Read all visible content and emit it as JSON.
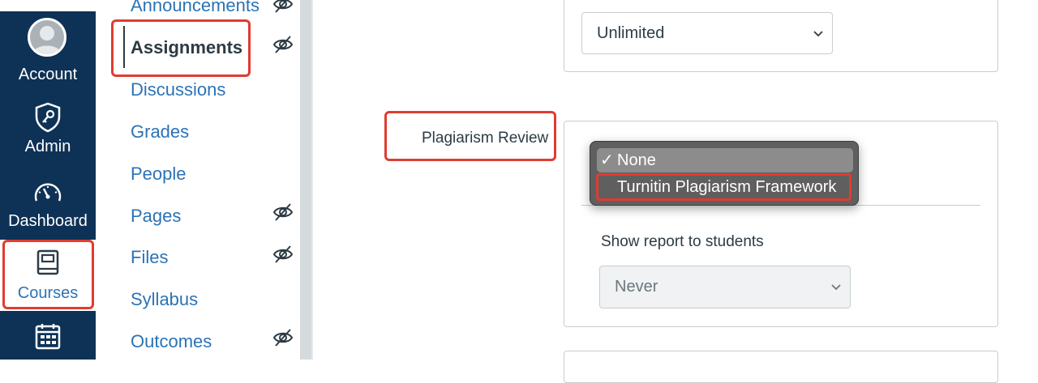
{
  "global_nav": {
    "account": "Account",
    "admin": "Admin",
    "dashboard": "Dashboard",
    "courses": "Courses"
  },
  "course_nav": {
    "items": [
      {
        "label": "Announcements"
      },
      {
        "label": "Assignments"
      },
      {
        "label": "Discussions"
      },
      {
        "label": "Grades"
      },
      {
        "label": "People"
      },
      {
        "label": "Pages"
      },
      {
        "label": "Files"
      },
      {
        "label": "Syllabus"
      },
      {
        "label": "Outcomes"
      }
    ]
  },
  "main": {
    "attempts_select_value": "Unlimited",
    "plagiarism_label": "Plagiarism Review",
    "plagiarism_options": [
      "None",
      "Turnitin Plagiarism Framework"
    ],
    "plagiarism_checkmark": "✓",
    "show_report_label": "Show report to students",
    "show_report_value": "Never"
  },
  "colors": {
    "nav_bg": "#0e3256",
    "link": "#2b73b6",
    "highlight_box": "#e03c31"
  }
}
